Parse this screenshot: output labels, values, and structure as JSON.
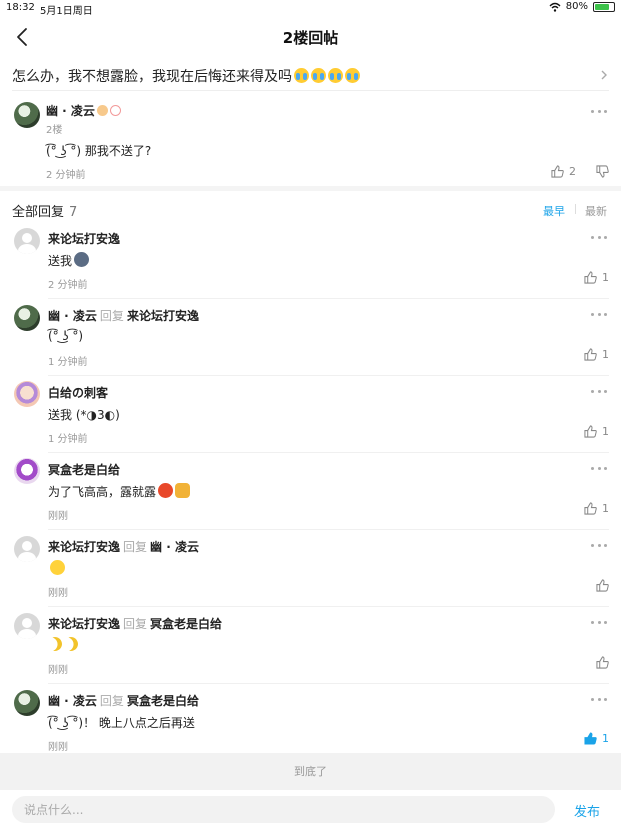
{
  "status_bar": {
    "time": "18:32",
    "date": "5月1日周日",
    "battery": "80%",
    "battery_level": 0.8
  },
  "nav": {
    "title": "2楼回帖"
  },
  "thread": {
    "title": "怎么办，我不想露脸，我现在后悔还来得及吗"
  },
  "floor_post": {
    "author": "幽 · 凌云",
    "floor": "2楼",
    "text": "(͡° ͜ʖ ͡°) 那我不送了?",
    "time": "2 分钟前",
    "likes": "2"
  },
  "replies_header": {
    "label": "全部回复",
    "count": "7",
    "sort_earliest": "最早",
    "sort_latest": "最新"
  },
  "replies": [
    {
      "author": "来论坛打安逸",
      "reply_word": "",
      "reply_to": "",
      "text": "送我",
      "time": "2 分钟前",
      "likes": "1"
    },
    {
      "author": "幽 · 凌云",
      "reply_word": "回复",
      "reply_to": "来论坛打安逸",
      "text": "(͡° ͜ʖ ͡°)",
      "time": "1 分钟前",
      "likes": "1"
    },
    {
      "author": "白给の刺客",
      "reply_word": "",
      "reply_to": "",
      "text": "送我 (*◑3◐)",
      "time": "1 分钟前",
      "likes": "1"
    },
    {
      "author": "冥盒老是白给",
      "reply_word": "",
      "reply_to": "",
      "text": "为了飞高高，露就露",
      "time": "刚刚",
      "likes": "1"
    },
    {
      "author": "来论坛打安逸",
      "reply_word": "回复",
      "reply_to": "幽 · 凌云",
      "text": "",
      "time": "刚刚",
      "likes": ""
    },
    {
      "author": "来论坛打安逸",
      "reply_word": "回复",
      "reply_to": "冥盒老是白给",
      "text": "",
      "time": "刚刚",
      "likes": ""
    },
    {
      "author": "幽 · 凌云",
      "reply_word": "回复",
      "reply_to": "冥盒老是白给",
      "text": "(͡° ͜ʖ ͡°)！ 晚上八点之后再送",
      "time": "刚刚",
      "likes": "1"
    }
  ],
  "end_text": "到底了",
  "comment": {
    "placeholder": "说点什么...",
    "publish": "发布"
  },
  "colors": {
    "accent": "#1aa3e8",
    "muted": "#999999"
  }
}
